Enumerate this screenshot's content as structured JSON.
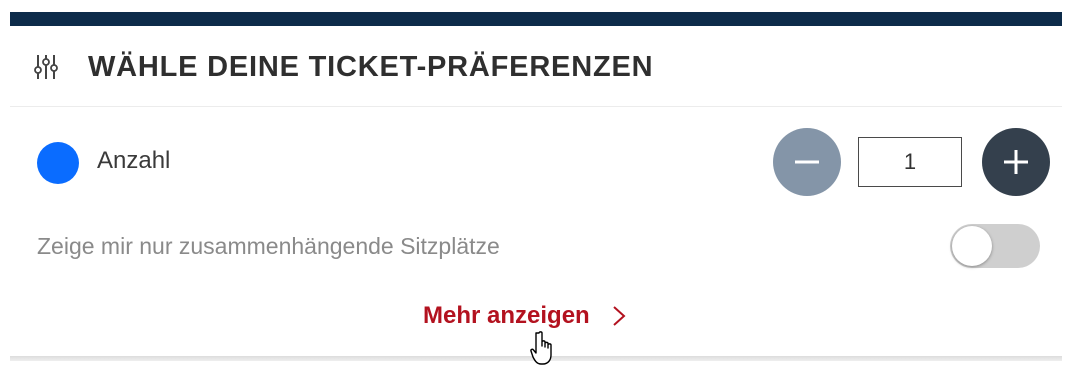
{
  "header": {
    "title": "WÄHLE DEINE TICKET-PRÄFERENZEN",
    "icon": "sliders-icon"
  },
  "quantity": {
    "label": "Anzahl",
    "value": "1",
    "decrement_icon": "minus-icon",
    "increment_icon": "plus-icon"
  },
  "contiguous_seats": {
    "label": "Zeige mir nur zusammenhängende Sitzplätze",
    "enabled": false
  },
  "more": {
    "label": "Mehr anzeigen",
    "icon": "chevron-right-icon"
  },
  "colors": {
    "topbar": "#0d2b4a",
    "dot": "#0a6cff",
    "minus_button": "#8495a8",
    "plus_button": "#34404d",
    "link": "#b3121f",
    "toggle_off": "#cfcfcf"
  }
}
